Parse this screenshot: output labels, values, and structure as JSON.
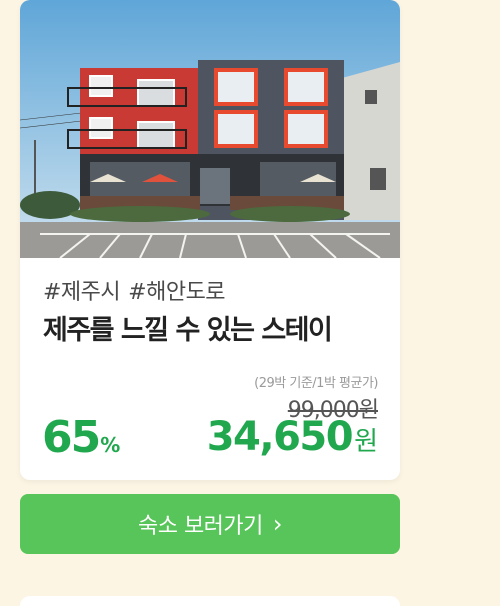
{
  "listing": {
    "tags": [
      "#제주시",
      "#해안도로"
    ],
    "title": "제주를 느낄 수 있는 스테이",
    "price_note": "(29박 기준/1박 평균가)",
    "original_price": "99,000원",
    "discount_value": "65",
    "discount_unit": "%",
    "price_value": "34,650",
    "price_unit": "원"
  },
  "cta": {
    "label": "숙소 보러가기",
    "chevron": "›",
    "icon": "chevron-right-icon"
  },
  "colors": {
    "background": "#fdf5e4",
    "accent_green": "#21a84f",
    "button_green": "#57c559"
  }
}
